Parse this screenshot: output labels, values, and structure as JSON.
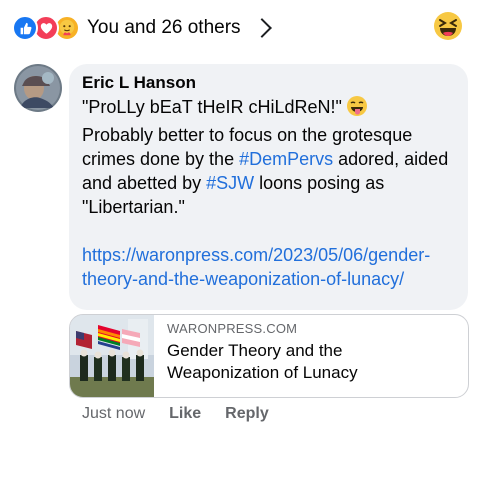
{
  "reactions": {
    "icons": [
      "like-icon",
      "love-icon",
      "care-icon"
    ],
    "count_text": "You and 26 others"
  },
  "comment": {
    "author": "Eric L Hanson",
    "line1": "\"ProLLy bEaT tHeIR cHiLdReN!\"",
    "text_a": "Probably better to focus on the grotesque crimes done by the ",
    "hashtag1": "#DemPervs",
    "text_b": " adored, aided and abetted by ",
    "hashtag2": "#SJW",
    "text_c": " loons posing  as \"Libertarian.\"",
    "link": "https://waronpress.com/2023/05/06/gender-theory-and-the-weaponization-of-lunacy/"
  },
  "preview": {
    "domain": "WARONPRESS.COM",
    "title": "Gender Theory and the Weaponization of Lunacy"
  },
  "actions": {
    "time": "Just now",
    "like": "Like",
    "reply": "Reply"
  },
  "colors": {
    "like_blue": "#1877f2",
    "love_red": "#f33e58",
    "care_yellow": "#f7b125",
    "hashtag_blue": "#216fdb",
    "bubble_bg": "#f0f2f5"
  }
}
